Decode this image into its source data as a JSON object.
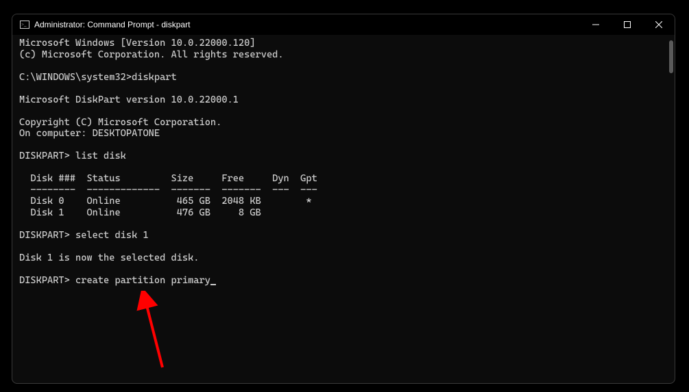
{
  "titlebar": {
    "title": "Administrator: Command Prompt - diskpart"
  },
  "terminal": {
    "line01": "Microsoft Windows [Version 10.0.22000.120]",
    "line02": "(c) Microsoft Corporation. All rights reserved.",
    "blank1": "",
    "line03": "C:\\WINDOWS\\system32>diskpart",
    "blank2": "",
    "line04": "Microsoft DiskPart version 10.0.22000.1",
    "blank3": "",
    "line05": "Copyright (C) Microsoft Corporation.",
    "line06": "On computer: DESKTOPATONE",
    "blank4": "",
    "line07": "DISKPART> list disk",
    "blank5": "",
    "line08": "  Disk ###  Status         Size     Free     Dyn  Gpt",
    "line09": "  --------  -------------  -------  -------  ---  ---",
    "line10": "  Disk 0    Online          465 GB  2048 KB        *",
    "line11": "  Disk 1    Online          476 GB     8 GB",
    "blank6": "",
    "line12": "DISKPART> select disk 1",
    "blank7": "",
    "line13": "Disk 1 is now the selected disk.",
    "blank8": "",
    "line14": "DISKPART> create partition primary"
  }
}
